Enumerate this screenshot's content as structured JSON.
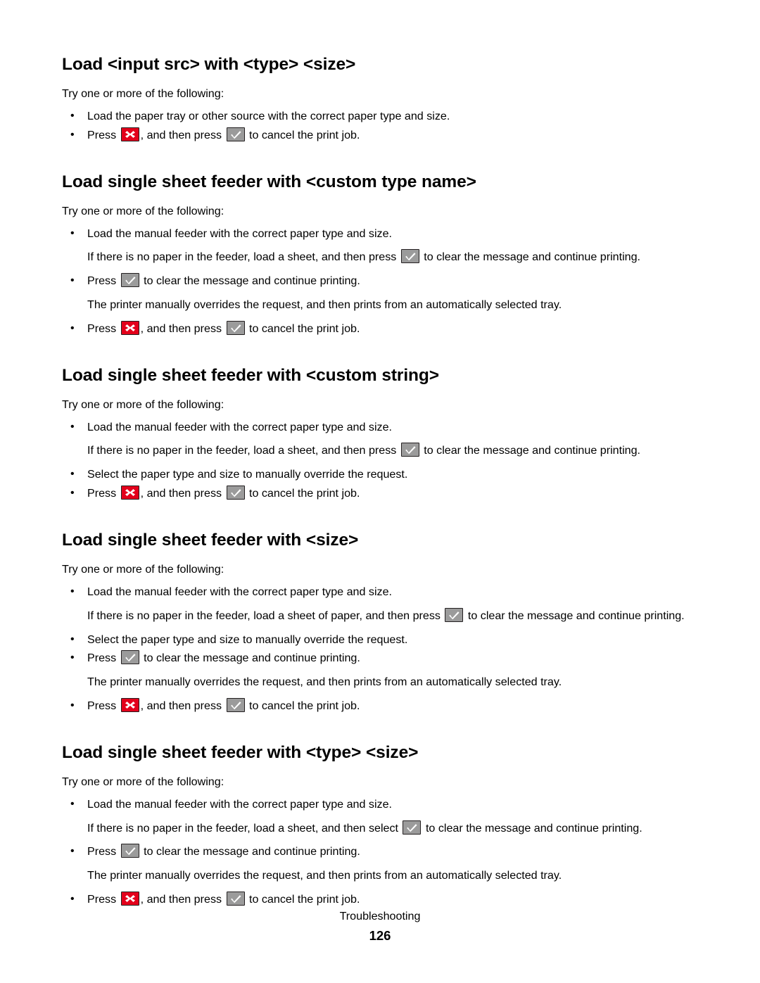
{
  "document": {
    "footer": {
      "breadcrumb": "Troubleshooting",
      "page_number": "126"
    },
    "icons": {
      "cancel": {
        "name": "cancel-x-key-icon",
        "color": "#e3001b",
        "border": "#231f20",
        "glyph": "✕"
      },
      "select": {
        "name": "select-check-key-icon",
        "color": "#9b9b9b",
        "border": "#231f20",
        "glyph": "✓"
      }
    },
    "sections": [
      {
        "title": "Load <input src> with <type> <size>",
        "intro": "Try one or more of the following:",
        "items": [
          {
            "kind": "bullet",
            "parts": [
              {
                "type": "text",
                "value": "Load the paper tray or other source with the correct paper type and size."
              }
            ]
          },
          {
            "kind": "bullet",
            "parts": [
              {
                "type": "text",
                "value": "Press "
              },
              {
                "type": "icon",
                "value": "cancel"
              },
              {
                "type": "text",
                "value": ", and then press "
              },
              {
                "type": "icon",
                "value": "select"
              },
              {
                "type": "text",
                "value": " to cancel the print job."
              }
            ]
          }
        ]
      },
      {
        "title": "Load single sheet feeder with <custom type name>",
        "intro": "Try one or more of the following:",
        "items": [
          {
            "kind": "bullet",
            "parts": [
              {
                "type": "text",
                "value": "Load the manual feeder with the correct paper type and size."
              }
            ]
          },
          {
            "kind": "note",
            "parts": [
              {
                "type": "text",
                "value": "If there is no paper in the feeder, load a sheet, and then press "
              },
              {
                "type": "icon",
                "value": "select"
              },
              {
                "type": "text",
                "value": " to clear the message and continue printing."
              }
            ]
          },
          {
            "kind": "bullet",
            "parts": [
              {
                "type": "text",
                "value": "Press "
              },
              {
                "type": "icon",
                "value": "select"
              },
              {
                "type": "text",
                "value": " to clear the message and continue printing."
              }
            ]
          },
          {
            "kind": "note",
            "parts": [
              {
                "type": "text",
                "value": "The printer manually overrides the request, and then prints from an automatically selected tray."
              }
            ]
          },
          {
            "kind": "bullet",
            "parts": [
              {
                "type": "text",
                "value": "Press "
              },
              {
                "type": "icon",
                "value": "cancel"
              },
              {
                "type": "text",
                "value": ", and then press "
              },
              {
                "type": "icon",
                "value": "select"
              },
              {
                "type": "text",
                "value": " to cancel the print job."
              }
            ]
          }
        ]
      },
      {
        "title": "Load single sheet feeder with <custom string>",
        "intro": "Try one or more of the following:",
        "items": [
          {
            "kind": "bullet",
            "parts": [
              {
                "type": "text",
                "value": "Load the manual feeder with the correct paper type and size."
              }
            ]
          },
          {
            "kind": "note",
            "parts": [
              {
                "type": "text",
                "value": "If there is no paper in the feeder, load a sheet, and then press "
              },
              {
                "type": "icon",
                "value": "select"
              },
              {
                "type": "text",
                "value": " to clear the message and continue printing."
              }
            ]
          },
          {
            "kind": "bullet",
            "parts": [
              {
                "type": "text",
                "value": "Select the paper type and size to manually override the request."
              }
            ]
          },
          {
            "kind": "bullet",
            "parts": [
              {
                "type": "text",
                "value": "Press "
              },
              {
                "type": "icon",
                "value": "cancel"
              },
              {
                "type": "text",
                "value": ", and then press "
              },
              {
                "type": "icon",
                "value": "select"
              },
              {
                "type": "text",
                "value": " to cancel the print job."
              }
            ]
          }
        ]
      },
      {
        "title": "Load single sheet feeder with <size>",
        "intro": "Try one or more of the following:",
        "items": [
          {
            "kind": "bullet",
            "parts": [
              {
                "type": "text",
                "value": "Load the manual feeder with the correct paper type and size."
              }
            ]
          },
          {
            "kind": "note",
            "parts": [
              {
                "type": "text",
                "value": "If there is no paper in the feeder, load a sheet of paper, and then press "
              },
              {
                "type": "icon",
                "value": "select"
              },
              {
                "type": "text",
                "value": " to clear the message and continue printing."
              }
            ]
          },
          {
            "kind": "bullet",
            "parts": [
              {
                "type": "text",
                "value": "Select the paper type and size to manually override the request."
              }
            ]
          },
          {
            "kind": "bullet",
            "parts": [
              {
                "type": "text",
                "value": "Press "
              },
              {
                "type": "icon",
                "value": "select"
              },
              {
                "type": "text",
                "value": " to clear the message and continue printing."
              }
            ]
          },
          {
            "kind": "note",
            "parts": [
              {
                "type": "text",
                "value": "The printer manually overrides the request, and then prints from an automatically selected tray."
              }
            ]
          },
          {
            "kind": "bullet",
            "parts": [
              {
                "type": "text",
                "value": "Press "
              },
              {
                "type": "icon",
                "value": "cancel"
              },
              {
                "type": "text",
                "value": ", and then press "
              },
              {
                "type": "icon",
                "value": "select"
              },
              {
                "type": "text",
                "value": " to cancel the print job."
              }
            ]
          }
        ]
      },
      {
        "title": "Load single sheet feeder with <type> <size>",
        "intro": "Try one or more of the following:",
        "items": [
          {
            "kind": "bullet",
            "parts": [
              {
                "type": "text",
                "value": "Load the manual feeder with the correct paper type and size."
              }
            ]
          },
          {
            "kind": "note",
            "parts": [
              {
                "type": "text",
                "value": "If there is no paper in the feeder, load a sheet, and then select "
              },
              {
                "type": "icon",
                "value": "select"
              },
              {
                "type": "text",
                "value": " to clear the message and continue printing."
              }
            ]
          },
          {
            "kind": "bullet",
            "parts": [
              {
                "type": "text",
                "value": "Press "
              },
              {
                "type": "icon",
                "value": "select"
              },
              {
                "type": "text",
                "value": " to clear the message and continue printing."
              }
            ]
          },
          {
            "kind": "note",
            "parts": [
              {
                "type": "text",
                "value": "The printer manually overrides the request, and then prints from an automatically selected tray."
              }
            ]
          },
          {
            "kind": "bullet",
            "parts": [
              {
                "type": "text",
                "value": "Press "
              },
              {
                "type": "icon",
                "value": "cancel"
              },
              {
                "type": "text",
                "value": ", and then press "
              },
              {
                "type": "icon",
                "value": "select"
              },
              {
                "type": "text",
                "value": " to cancel the print job."
              }
            ]
          }
        ]
      }
    ]
  }
}
